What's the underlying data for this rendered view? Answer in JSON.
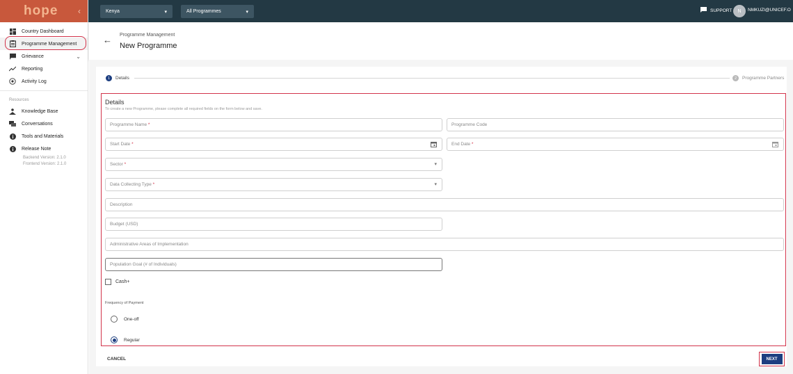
{
  "app": {
    "logo": "hope",
    "collapse_icon": "chevron-left-icon"
  },
  "sidebar": {
    "items": [
      {
        "label": "Country Dashboard",
        "icon": "dashboard-icon"
      },
      {
        "label": "Programme Management",
        "icon": "clipboard-icon"
      },
      {
        "label": "Grievance",
        "icon": "feedback-icon"
      },
      {
        "label": "Reporting",
        "icon": "trending-up-icon"
      },
      {
        "label": "Activity Log",
        "icon": "activity-icon"
      }
    ],
    "resources_label": "Resources",
    "resources": [
      {
        "label": "Knowledge Base",
        "icon": "knowledge-icon"
      },
      {
        "label": "Conversations",
        "icon": "chat-icon"
      },
      {
        "label": "Tools and Materials",
        "icon": "info-icon"
      },
      {
        "label": "Release Note",
        "icon": "info-icon"
      }
    ],
    "backend_version": "Backend Version: 2.1.0",
    "frontend_version": "Frontend Version: 2.1.0"
  },
  "topbar": {
    "country": "Kenya",
    "programme": "All Programmes",
    "support": "SUPPORT",
    "avatar_initial": "N",
    "user": "NMKUZI@UNICEF.O"
  },
  "header": {
    "breadcrumb": "Programme Management",
    "title": "New Programme"
  },
  "stepper": {
    "step1_num": "1",
    "step1": "Details",
    "step2_num": "2",
    "step2": "Programme Partners"
  },
  "form": {
    "title": "Details",
    "subtitle": "To create a new Programme, please complete all required fields on the form below and save.",
    "programme_name": "Programme Name",
    "programme_code": "Programme Code",
    "start_date": "Start Date",
    "end_date": "End Date",
    "sector": "Sector",
    "data_collecting_type": "Data Collecting Type",
    "description": "Description",
    "budget": "Budget (USD)",
    "admin_areas": "Administrative Areas of Implementation",
    "population_goal": "Population Goal (# of Individuals)",
    "cash_label": "Cash+",
    "frequency_label": "Frequency of Payment",
    "freq_one_off": "One-off",
    "freq_regular": "Regular",
    "frequency_selected": "Regular",
    "required_marker": "*"
  },
  "actions": {
    "cancel": "CANCEL",
    "next": "NEXT"
  },
  "colors": {
    "accent": "#1c3e80",
    "topbar": "#233944",
    "logo_bar": "#c8583c",
    "highlight": "#d2334a"
  }
}
